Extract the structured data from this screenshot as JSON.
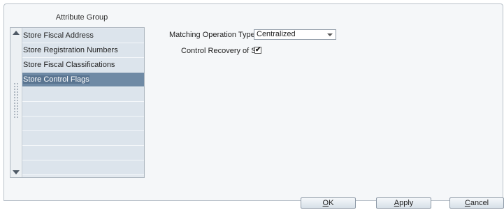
{
  "attribute_group": {
    "title": "Attribute Group",
    "items": [
      {
        "label": "Store Fiscal Address"
      },
      {
        "label": "Store Registration Numbers"
      },
      {
        "label": "Store Fiscal Classifications"
      },
      {
        "label": "Store Control Flags",
        "selected": true
      }
    ]
  },
  "form": {
    "matching_operation_type_label": "Matching Operation Type",
    "matching_operation_type_value": "Centralized",
    "control_recovery_label": "Control Recovery of ST",
    "control_recovery_checked": true,
    "checkmark": "✔"
  },
  "buttons": {
    "ok": {
      "mnemonic": "O",
      "rest": "K"
    },
    "apply": {
      "mnemonic": "A",
      "rest": "pply"
    },
    "cancel": {
      "mnemonic": "C",
      "rest": "ancel"
    }
  }
}
